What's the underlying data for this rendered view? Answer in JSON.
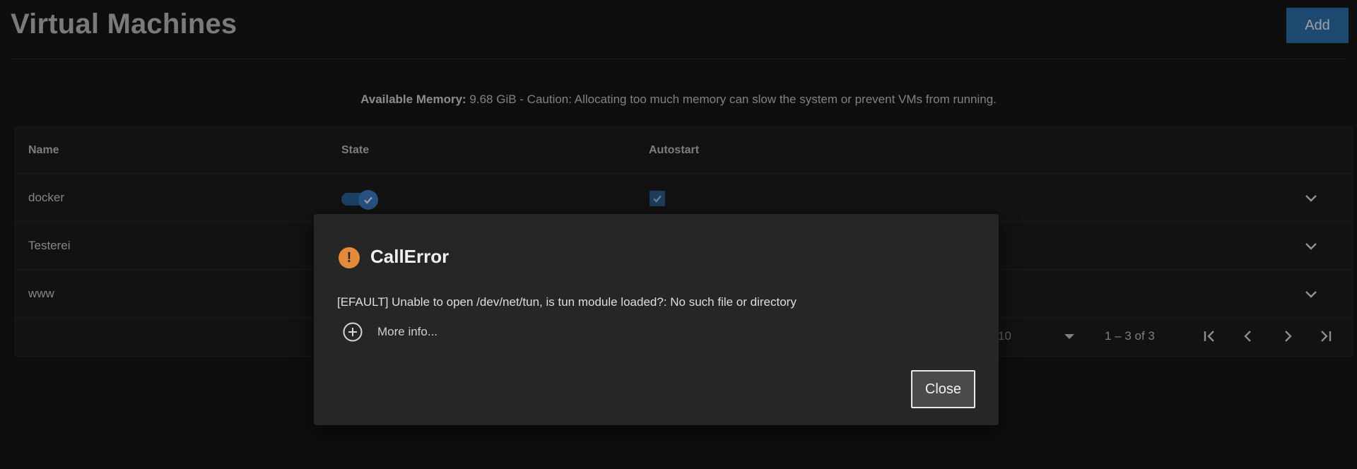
{
  "page": {
    "title": "Virtual Machines",
    "add_label": "Add"
  },
  "memory": {
    "label": "Available Memory:",
    "text": " 9.68 GiB - Caution: Allocating too much memory can slow the system or prevent VMs from running."
  },
  "table": {
    "columns": [
      "Name",
      "State",
      "Autostart"
    ],
    "rows": [
      {
        "name": "docker",
        "state_on": true,
        "autostart": true
      },
      {
        "name": "Testerei"
      },
      {
        "name": "www"
      }
    ]
  },
  "paginator": {
    "page_size": "10",
    "range": "1 – 3 of 3"
  },
  "dialog": {
    "title": "CallError",
    "message": "[EFAULT] Unable to open /dev/net/tun, is tun module loaded?: No such file or directory",
    "more_info_label": "More info...",
    "close_label": "Close"
  },
  "colors": {
    "accent": "#2d6da8",
    "error": "#e48a3c",
    "background": "#151515",
    "dialog": "#262626"
  },
  "icons": [
    "chevron-down-icon",
    "checkmark-icon",
    "warning-icon",
    "plus-circle-icon",
    "first-page-icon",
    "previous-page-icon",
    "next-page-icon",
    "last-page-icon"
  ]
}
